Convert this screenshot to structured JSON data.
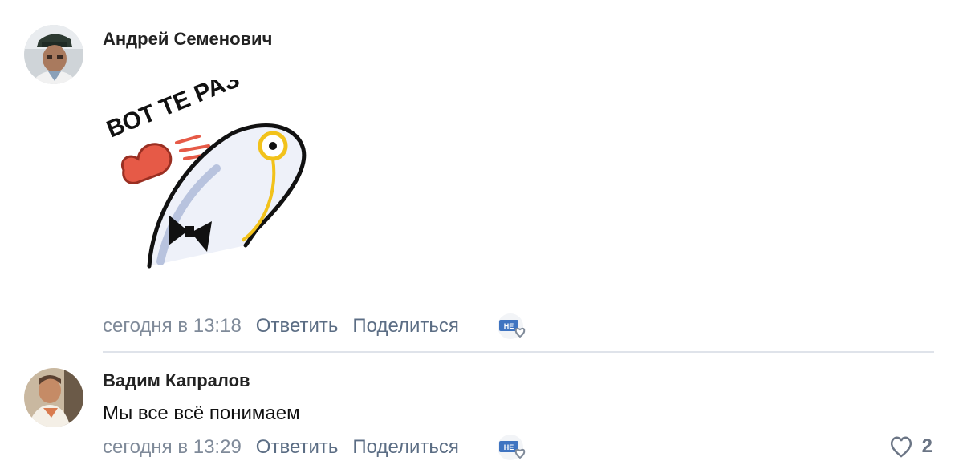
{
  "comments": [
    {
      "author": "Андрей Семенович",
      "sticker_text": "ВОТ ТЕ РАЗ",
      "timestamp": "сегодня в 13:18",
      "reply_label": "Ответить",
      "share_label": "Поделиться",
      "reaction_badge": "НЕ"
    },
    {
      "author": "Вадим Капралов",
      "text": "Мы все всё понимаем",
      "timestamp": "сегодня в 13:29",
      "reply_label": "Ответить",
      "share_label": "Поделиться",
      "reaction_badge": "НЕ",
      "like_count": "2"
    }
  ],
  "colors": {
    "author": "#222222",
    "meta_gray": "#7f8a99",
    "link": "#5b6d84",
    "divider": "#dfe3ea",
    "sticker_red": "#e65a47",
    "sticker_yellow": "#f2c21b",
    "badge_blue": "#3f74c1"
  }
}
